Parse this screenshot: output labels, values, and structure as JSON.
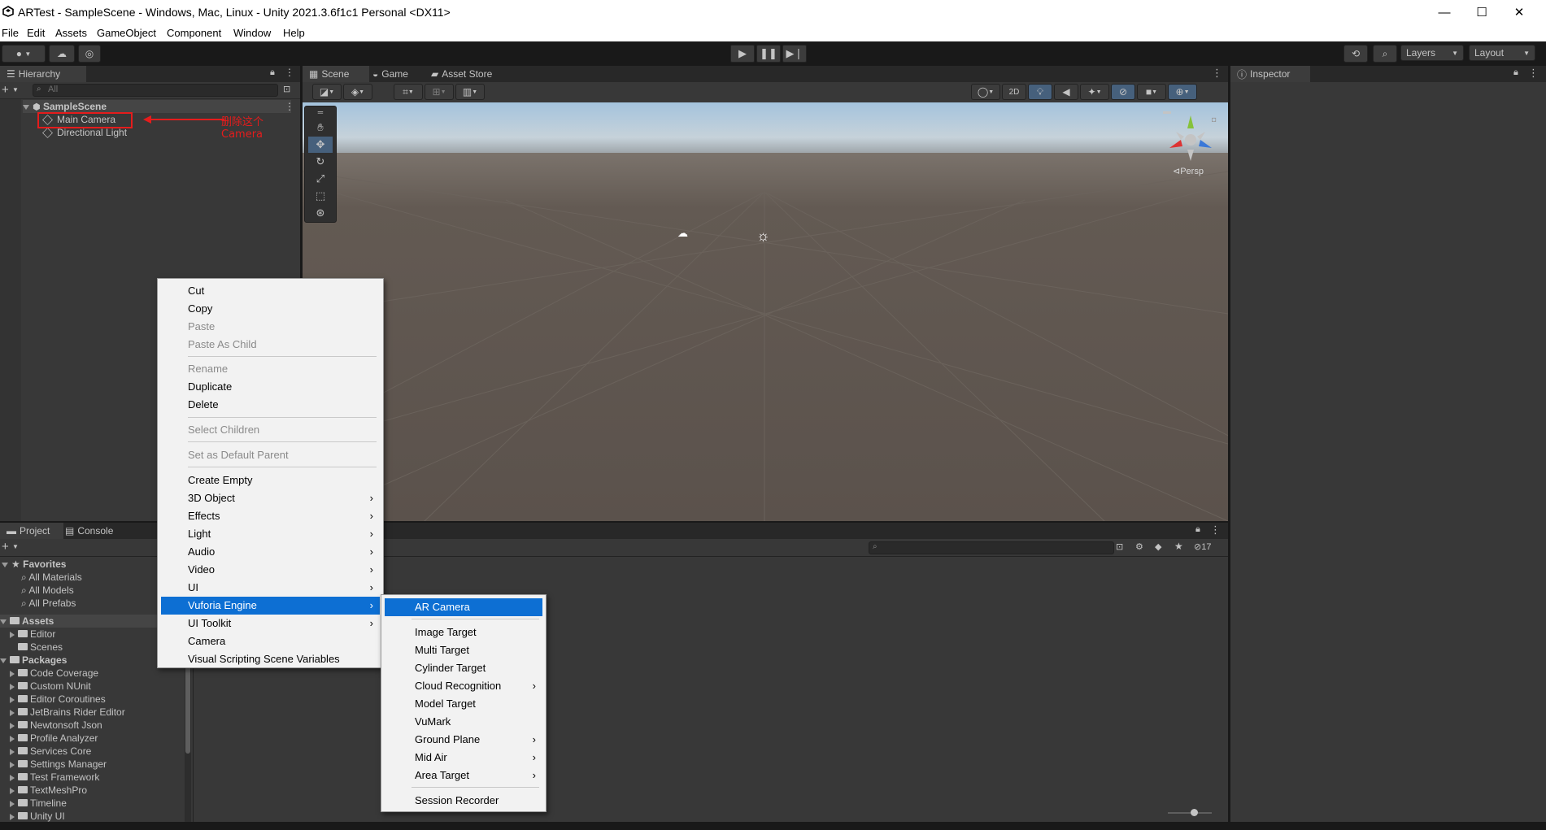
{
  "window": {
    "title": "ARTest - SampleScene - Windows, Mac, Linux - Unity 2021.3.6f1c1 Personal <DX11>",
    "minimize": "—",
    "maximize": "☐",
    "close": "✕"
  },
  "menubar": [
    "File",
    "Edit",
    "Assets",
    "GameObject",
    "Component",
    "Window",
    "Help"
  ],
  "toolbar": {
    "layers_label": "Layers",
    "layout_label": "Layout"
  },
  "hierarchy": {
    "tab": "Hierarchy",
    "search_placeholder": "All",
    "scene_name": "SampleScene",
    "items": [
      "Main Camera",
      "Directional Light"
    ],
    "annotation": "删除这个Camera"
  },
  "scene": {
    "tabs": [
      "Scene",
      "Game",
      "Asset Store"
    ],
    "btn_2d": "2D",
    "persp_label": "Persp"
  },
  "inspector": {
    "tab": "Inspector"
  },
  "project": {
    "tabs": [
      "Project",
      "Console"
    ],
    "favorites_label": "Favorites",
    "favorites": [
      "All Materials",
      "All Models",
      "All Prefabs"
    ],
    "assets_label": "Assets",
    "assets": [
      "Editor",
      "Scenes"
    ],
    "packages_label": "Packages",
    "packages": [
      "Code Coverage",
      "Custom NUnit",
      "Editor Coroutines",
      "JetBrains Rider Editor",
      "Newtonsoft Json",
      "Profile Analyzer",
      "Services Core",
      "Settings Manager",
      "Test Framework",
      "TextMeshPro",
      "Timeline",
      "Unity UI"
    ],
    "hidden_count": "17"
  },
  "context_menu": {
    "items": [
      {
        "label": "Cut",
        "disabled": false
      },
      {
        "label": "Copy",
        "disabled": false
      },
      {
        "label": "Paste",
        "disabled": true
      },
      {
        "label": "Paste As Child",
        "disabled": true
      },
      {
        "label": "Rename",
        "disabled": true
      },
      {
        "label": "Duplicate",
        "disabled": false
      },
      {
        "label": "Delete",
        "disabled": false
      },
      {
        "label": "Select Children",
        "disabled": true
      },
      {
        "label": "Set as Default Parent",
        "disabled": true
      },
      {
        "label": "Create Empty",
        "disabled": false
      },
      {
        "label": "3D Object",
        "disabled": false,
        "submenu": true
      },
      {
        "label": "Effects",
        "disabled": false,
        "submenu": true
      },
      {
        "label": "Light",
        "disabled": false,
        "submenu": true
      },
      {
        "label": "Audio",
        "disabled": false,
        "submenu": true
      },
      {
        "label": "Video",
        "disabled": false,
        "submenu": true
      },
      {
        "label": "UI",
        "disabled": false,
        "submenu": true
      },
      {
        "label": "Vuforia Engine",
        "disabled": false,
        "submenu": true,
        "selected": true
      },
      {
        "label": "UI Toolkit",
        "disabled": false,
        "submenu": true
      },
      {
        "label": "Camera",
        "disabled": false
      },
      {
        "label": "Visual Scripting Scene Variables",
        "disabled": false
      }
    ],
    "arrow": "›"
  },
  "vuforia_menu": {
    "items": [
      {
        "label": "AR Camera",
        "selected": true
      },
      {
        "label": "Image Target"
      },
      {
        "label": "Multi Target"
      },
      {
        "label": "Cylinder Target"
      },
      {
        "label": "Cloud Recognition",
        "submenu": true
      },
      {
        "label": "Model Target"
      },
      {
        "label": "VuMark"
      },
      {
        "label": "Ground Plane",
        "submenu": true
      },
      {
        "label": "Mid Air",
        "submenu": true
      },
      {
        "label": "Area Target",
        "submenu": true
      },
      {
        "label": "Session Recorder"
      }
    ]
  },
  "colors": {
    "accent": "#0d6fd3",
    "annotation_red": "#e51c1c",
    "panel": "#383838",
    "tab_bar": "#282828"
  }
}
